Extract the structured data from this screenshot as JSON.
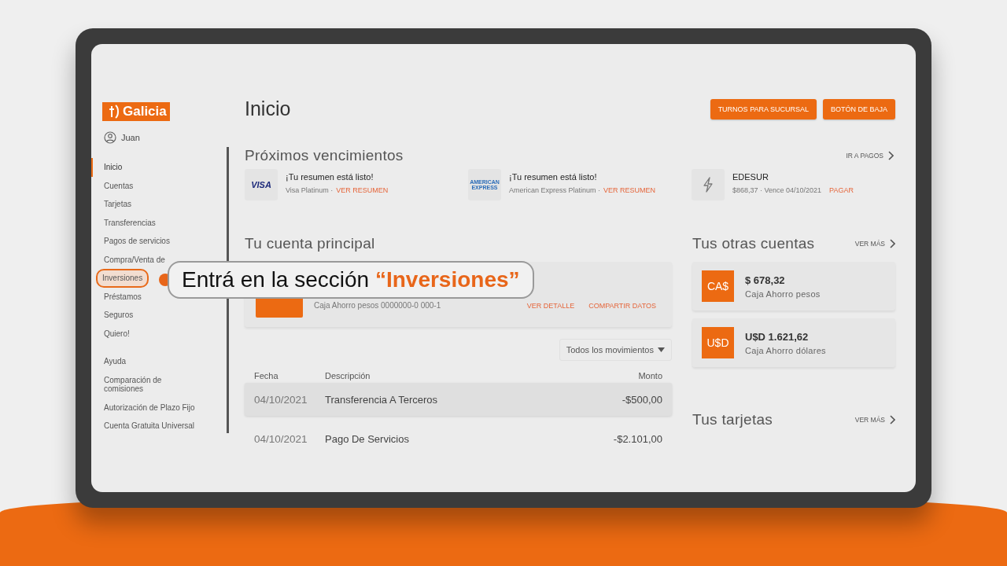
{
  "logo": {
    "text": "Galicia"
  },
  "user": {
    "name": "Juan"
  },
  "nav": [
    {
      "label": "Inicio",
      "selected": true,
      "highlighted": false
    },
    {
      "label": "Cuentas",
      "selected": false,
      "highlighted": false
    },
    {
      "label": "Tarjetas",
      "selected": false,
      "highlighted": false
    },
    {
      "label": "Transferencias",
      "selected": false,
      "highlighted": false
    },
    {
      "label": "Pagos de servicios",
      "selected": false,
      "highlighted": false
    },
    {
      "label": "Compra/Venta de",
      "selected": false,
      "highlighted": false
    },
    {
      "label": "Inversiones",
      "selected": false,
      "highlighted": true
    },
    {
      "label": "Préstamos",
      "selected": false,
      "highlighted": false
    },
    {
      "label": "Seguros",
      "selected": false,
      "highlighted": false
    },
    {
      "label": "Quiero!",
      "selected": false,
      "highlighted": false
    }
  ],
  "nav_secondary": [
    {
      "label": "Ayuda",
      "selected": false,
      "highlighted": false
    },
    {
      "label": "Comparación de comisiones",
      "selected": false,
      "highlighted": false
    },
    {
      "label": "Autorización de Plazo Fijo",
      "selected": false,
      "highlighted": false
    },
    {
      "label": "Cuenta Gratuita Universal",
      "selected": false,
      "highlighted": false
    }
  ],
  "page_title": "Inicio",
  "header_buttons": [
    "TURNOS PARA SUCURSAL",
    "BOTÓN DE BAJA"
  ],
  "upcoming": {
    "title": "Próximos vencimientos",
    "link": "IR A PAGOS",
    "items": [
      {
        "kind": "visa",
        "logo_text": "VISA",
        "title": "¡Tu resumen está listo!",
        "subtitle": "Visa Platinum ·",
        "action": "VER RESUMEN"
      },
      {
        "kind": "amex",
        "logo_text": "AMERICAN EXPRESS",
        "title": "¡Tu resumen está listo!",
        "subtitle": "American Express Platinum ·",
        "action": "VER RESUMEN"
      },
      {
        "kind": "service",
        "title": "EDESUR",
        "subtitle": "$868,37 · Vence 04/10/2021",
        "action": "PAGAR"
      }
    ]
  },
  "main_account": {
    "title": "Tu cuenta principal",
    "description": "Caja Ahorro pesos 0000000-0 000-1",
    "actions": [
      "VER DETALLE",
      "COMPARTIR DATOS"
    ]
  },
  "movements": {
    "filter": "Todos los movimientos",
    "columns": [
      "Fecha",
      "Descripción",
      "Monto"
    ],
    "rows": [
      {
        "date": "04/10/2021",
        "description": "Transferencia A Terceros",
        "amount": "-$500,00",
        "highlighted": true
      },
      {
        "date": "04/10/2021",
        "description": "Pago De Servicios",
        "amount": "-$2.101,00",
        "highlighted": false
      }
    ]
  },
  "other_accounts": {
    "title": "Tus otras cuentas",
    "link": "VER MÁS",
    "items": [
      {
        "badge": "CA$",
        "amount": "$ 678,32",
        "name": "Caja Ahorro pesos"
      },
      {
        "badge": "U$D",
        "amount": "U$D 1.621,62",
        "name": "Caja Ahorro dólares"
      }
    ]
  },
  "cards": {
    "title": "Tus tarjetas",
    "link": "VER MÁS"
  },
  "callout": {
    "text": "Entrá en la sección **“Inversiones”**"
  }
}
